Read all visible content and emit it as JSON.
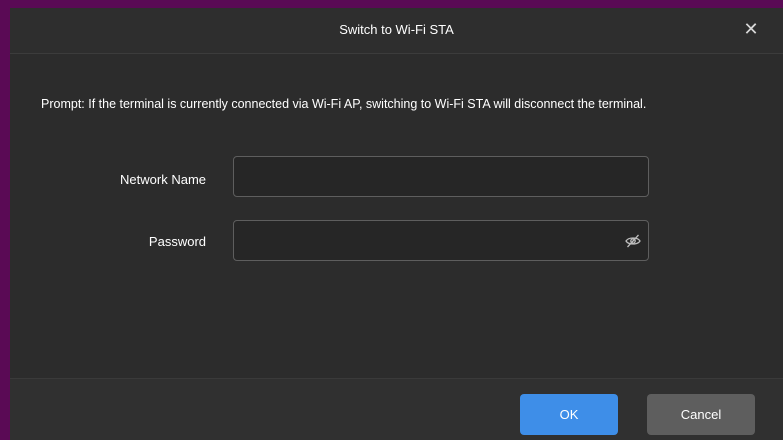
{
  "dialog": {
    "title": "Switch to Wi-Fi STA",
    "close_icon": "close-icon",
    "close_glyph": "✕",
    "prompt": "Prompt: If the terminal is currently connected via Wi-Fi AP, switching to Wi-Fi STA will disconnect the terminal."
  },
  "form": {
    "network_name": {
      "label": "Network Name",
      "value": "",
      "placeholder": ""
    },
    "password": {
      "label": "Password",
      "value": "",
      "placeholder": "",
      "toggle_icon": "eye-off-icon"
    }
  },
  "footer": {
    "ok_label": "OK",
    "cancel_label": "Cancel"
  },
  "colors": {
    "backdrop": "#5a0a55",
    "dialog_bg": "#2c2c2c",
    "primary_button": "#3e8ee8",
    "secondary_button": "#5e5e5e"
  }
}
